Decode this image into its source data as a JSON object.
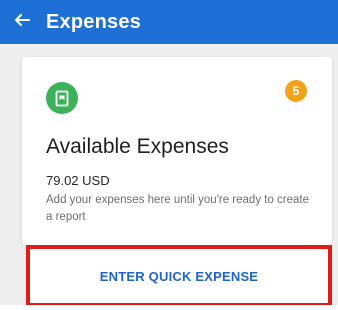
{
  "header": {
    "title": "Expenses",
    "back_icon": "arrow-left-icon",
    "color": "#1e6fd6"
  },
  "card": {
    "icon": "receipt-icon",
    "icon_color": "#3cb25b",
    "badge_count": "5",
    "badge_color": "#f2a21b",
    "title": "Available Expenses",
    "amount": "79.02 USD",
    "description": "Add your expenses here until you're ready to create a report"
  },
  "action": {
    "label": "ENTER QUICK EXPENSE",
    "label_color": "#1f64c8",
    "highlight_color": "#e11a1a"
  }
}
